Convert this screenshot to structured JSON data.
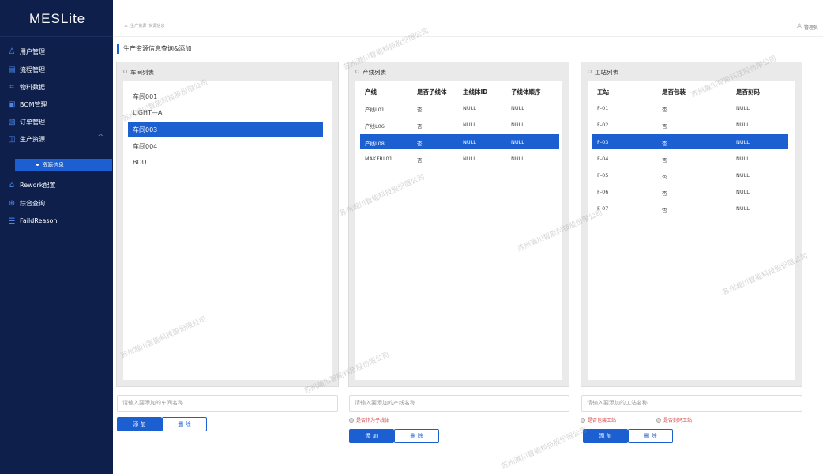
{
  "app": {
    "title": "MESLite"
  },
  "sidebar": {
    "items": [
      {
        "label": "用户管理",
        "icon": "user-icon",
        "glyph": "♙"
      },
      {
        "label": "流程管理",
        "icon": "flow-icon",
        "glyph": "▤"
      },
      {
        "label": "物料数据",
        "icon": "material-icon",
        "glyph": "⌗"
      },
      {
        "label": "BOM管理",
        "icon": "bom-icon",
        "glyph": "▣"
      },
      {
        "label": "订单管理",
        "icon": "order-icon",
        "glyph": "▧"
      },
      {
        "label": "生产资源",
        "icon": "resource-icon",
        "glyph": "◫",
        "arrow": "^"
      },
      {
        "label": "Rework配置",
        "icon": "home-icon",
        "glyph": "⌂"
      },
      {
        "label": "综合查询",
        "icon": "search-icon",
        "glyph": "⊕"
      },
      {
        "label": "FaildReason",
        "icon": "filter-icon",
        "glyph": "☰"
      }
    ],
    "submenu": {
      "label": "资源信息"
    }
  },
  "header": {
    "breadcrumb": "三 /生产资源 /资源信息",
    "user_icon": "user-icon",
    "user": "管理员"
  },
  "page": {
    "title": "生产资源信息查询&添加"
  },
  "workshop": {
    "title": "车间列表",
    "items": [
      "车间001",
      "LIGHT—A",
      "车间003",
      "车间004",
      "BDU"
    ],
    "selected_index": 2,
    "input_placeholder": "请输入要添加的车间名称...",
    "add_label": "添 加",
    "delete_label": "删 除"
  },
  "line": {
    "title": "产线列表",
    "headers": [
      "产线",
      "是否子线体",
      "主线体ID",
      "子线体顺序"
    ],
    "rows": [
      [
        "产线L01",
        "否",
        "NULL",
        "NULL"
      ],
      [
        "产线L06",
        "否",
        "NULL",
        "NULL"
      ],
      [
        "产线L08",
        "否",
        "NULL",
        "NULL"
      ],
      [
        "MAKERL01",
        "否",
        "NULL",
        "NULL"
      ]
    ],
    "selected_index": 2,
    "input_placeholder": "请输入要添加的产线名称...",
    "option_label": "是否作为子线体",
    "add_label": "添 加",
    "delete_label": "删 除"
  },
  "station": {
    "title": "工站列表",
    "headers": [
      "工站",
      "是否包装",
      "是否刻码"
    ],
    "rows": [
      [
        "F-01",
        "否",
        "NULL"
      ],
      [
        "F-02",
        "否",
        "NULL"
      ],
      [
        "F-03",
        "否",
        "NULL"
      ],
      [
        "F-04",
        "否",
        "NULL"
      ],
      [
        "F-05",
        "否",
        "NULL"
      ],
      [
        "F-06",
        "否",
        "NULL"
      ],
      [
        "F-07",
        "否",
        "NULL"
      ]
    ],
    "selected_index": 2,
    "input_placeholder": "请输入要添加的工站名称...",
    "option_pack_label": "是否包装工站",
    "option_code_label": "是否刻码工站",
    "add_label": "添 加",
    "delete_label": "删 除"
  },
  "watermark": "苏州瀚川智能科技股份限公司"
}
